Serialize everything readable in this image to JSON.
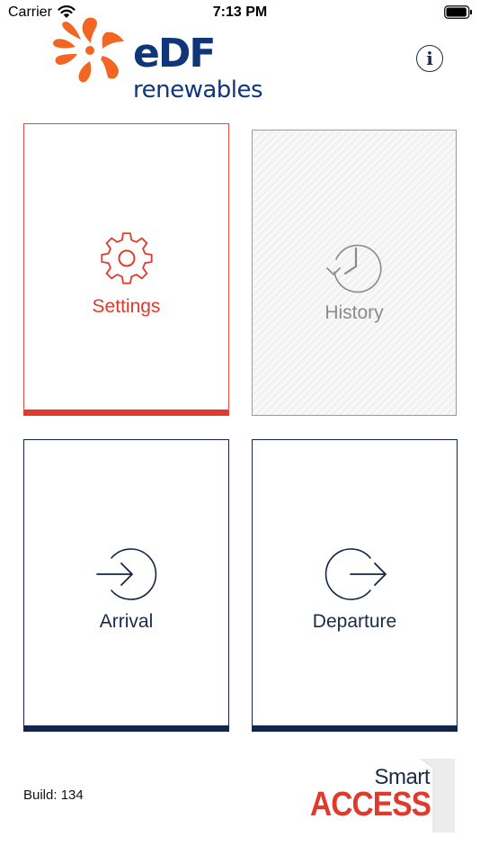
{
  "status_bar": {
    "carrier": "Carrier",
    "time": "7:13 PM",
    "battery_level": 0.95
  },
  "header": {
    "logo_wordmark": "eDF",
    "logo_subtitle": "renewables",
    "info_glyph": "i"
  },
  "tiles": [
    {
      "id": "settings",
      "label": "Settings",
      "icon": "gear-icon",
      "color": "#e03a2c"
    },
    {
      "id": "history",
      "label": "History",
      "icon": "history-clock-icon",
      "color": "#8a8a8a",
      "disabled": true
    },
    {
      "id": "arrival",
      "label": "Arrival",
      "icon": "arrival-arrow-icon",
      "color": "#142548"
    },
    {
      "id": "departure",
      "label": "Departure",
      "icon": "departure-arrow-icon",
      "color": "#142548"
    }
  ],
  "footer": {
    "build": "Build: 134",
    "brand_smart": "Smart",
    "brand_access": "ACCESS"
  },
  "colors": {
    "brand_red": "#e03a2c",
    "brand_navy": "#142548",
    "edf_blue": "#10367a",
    "edf_orange": "#f26522"
  }
}
